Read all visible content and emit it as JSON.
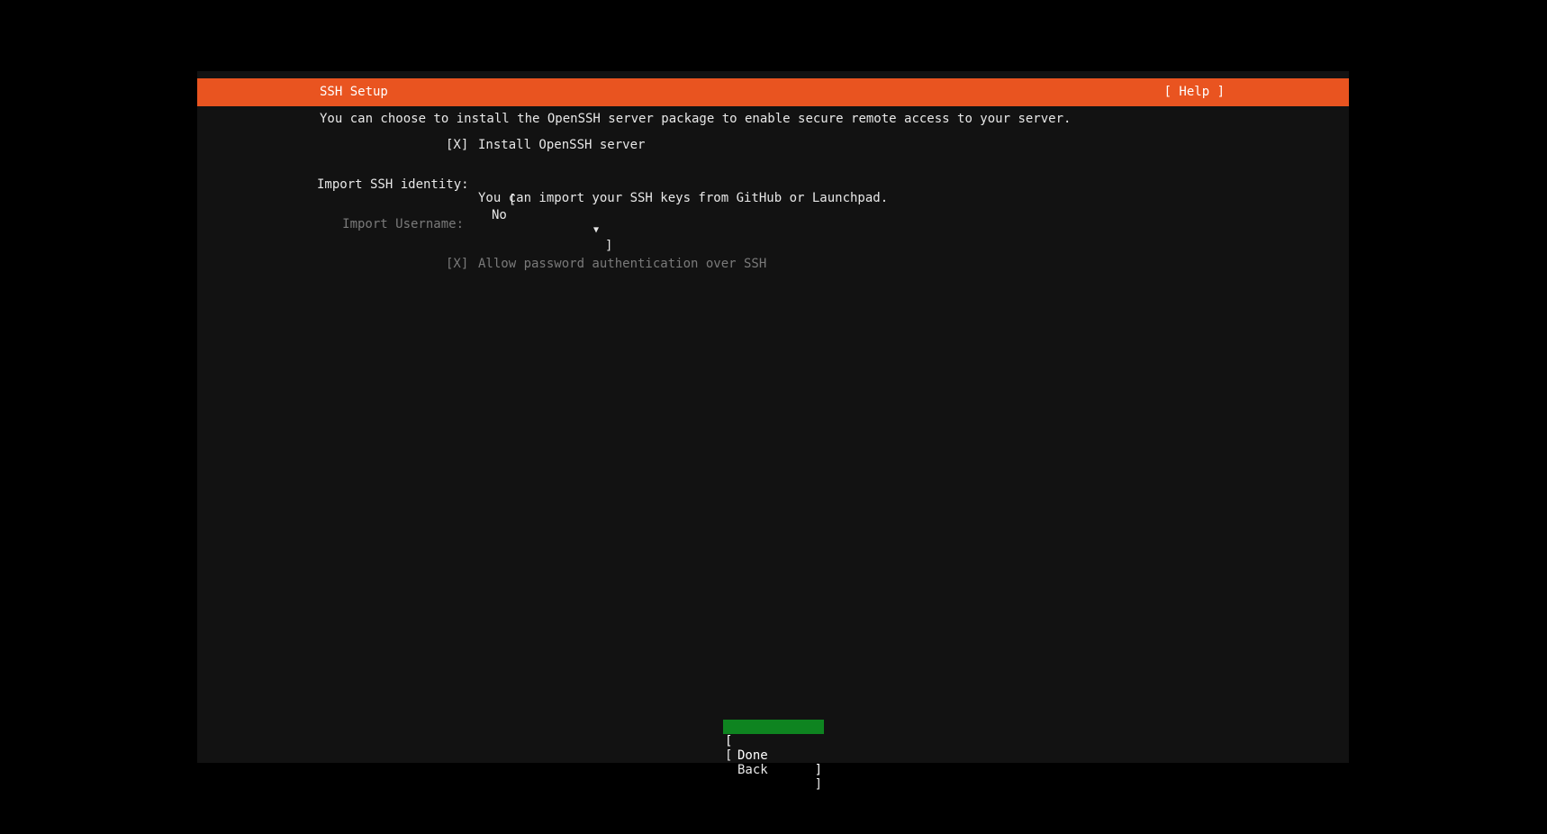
{
  "header": {
    "title": "SSH Setup",
    "help_label": "[ Help ]"
  },
  "description": "You can choose to install the OpenSSH server package to enable secure remote access to your server.",
  "install_openssh": {
    "checkbox": "[X]",
    "label": "Install OpenSSH server",
    "checked": true
  },
  "import_identity": {
    "label": "Import SSH identity:",
    "bracket_open": "[",
    "selected_value": "No",
    "arrow": "▼",
    "bracket_close": "]",
    "help_text": "You can import your SSH keys from GitHub or Launchpad."
  },
  "import_username": {
    "label": "Import Username:",
    "value": ""
  },
  "allow_password": {
    "checkbox": "[X]",
    "label": "Allow password authentication over SSH",
    "checked": true
  },
  "buttons": {
    "done_label": "Done",
    "back_label": "Back",
    "bracket_open": "[",
    "bracket_close": "]"
  },
  "colors": {
    "header_bg": "#e95420",
    "done_bg": "#0e8420",
    "screen_bg": "#121212"
  }
}
